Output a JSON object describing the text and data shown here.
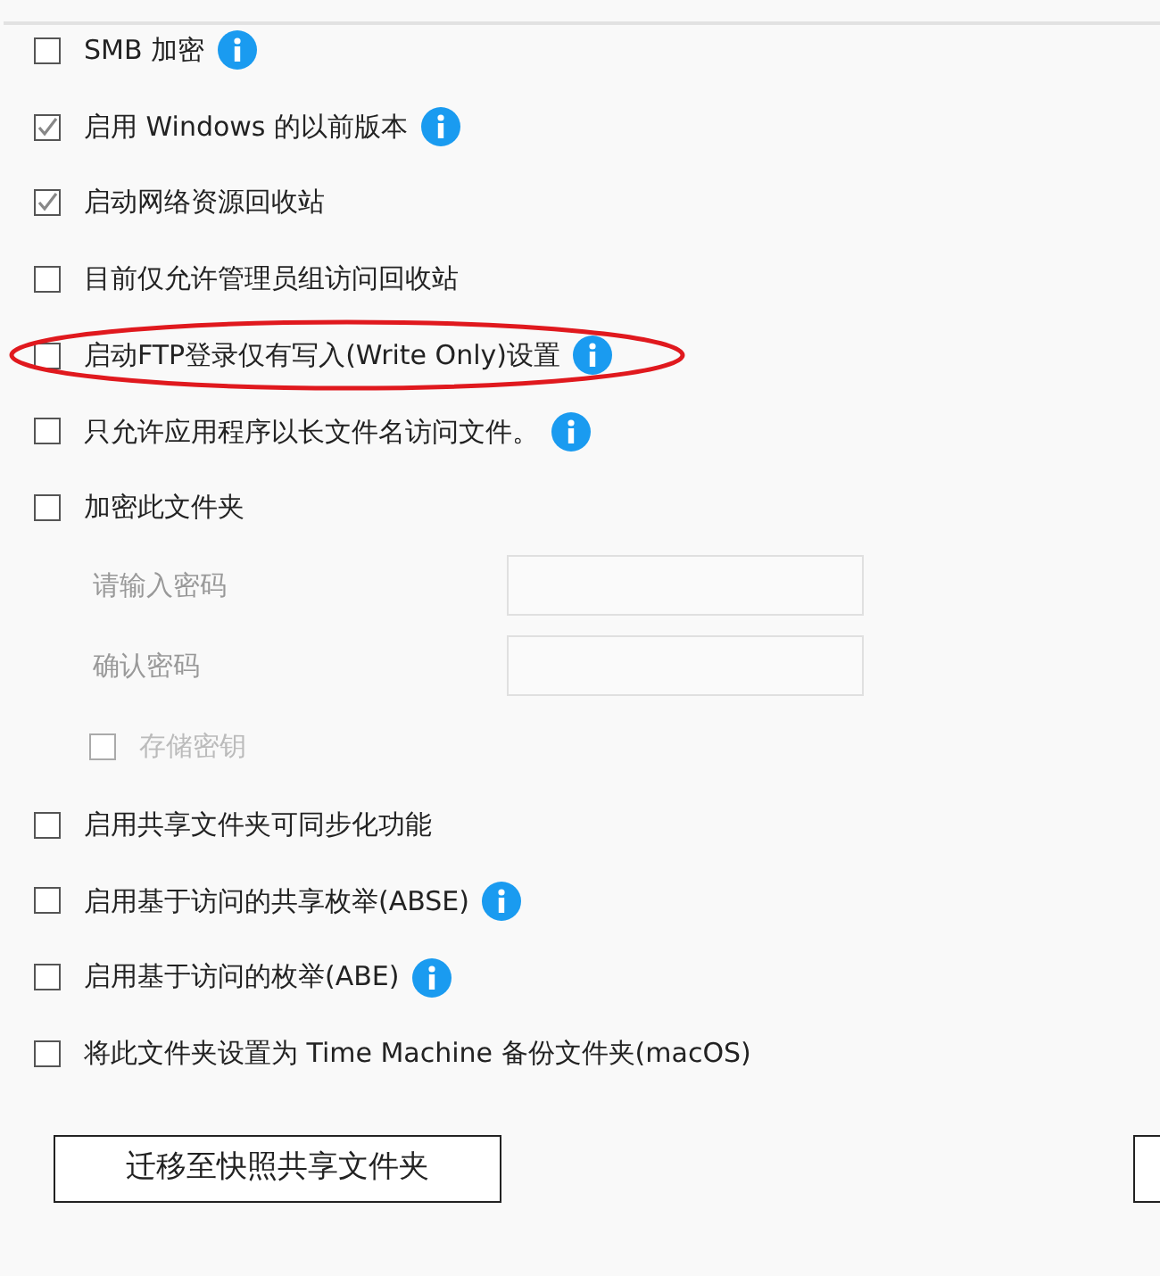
{
  "options": [
    {
      "kind": "checkbox",
      "label": "SMB 加密",
      "checked": false,
      "info": true
    },
    {
      "kind": "checkbox",
      "label": "启用 Windows 的以前版本",
      "checked": true,
      "info": true
    },
    {
      "kind": "checkbox",
      "label": "启动网络资源回收站",
      "checked": true,
      "info": false
    },
    {
      "kind": "checkbox",
      "label": "目前仅允许管理员组访问回收站",
      "checked": false,
      "info": false
    },
    {
      "kind": "checkbox",
      "label": "启动FTP登录仅有写入(Write Only)设置",
      "checked": false,
      "info": true,
      "highlighted": true
    },
    {
      "kind": "checkbox",
      "label": "只允许应用程序以长文件名访问文件。",
      "checked": false,
      "info": true
    },
    {
      "kind": "checkbox",
      "label": "加密此文件夹",
      "checked": false,
      "info": false
    },
    {
      "kind": "field",
      "label": "请输入密码"
    },
    {
      "kind": "field",
      "label": "确认密码"
    },
    {
      "kind": "subcheckbox",
      "label": "存储密钥",
      "checked": false,
      "disabled": true
    },
    {
      "kind": "checkbox",
      "label": "启用共享文件夹可同步化功能",
      "checked": false,
      "info": false
    },
    {
      "kind": "checkbox",
      "label": "启用基于访问的共享枚举(ABSE)",
      "checked": false,
      "info": true
    },
    {
      "kind": "checkbox",
      "label": "启用基于访问的枚举(ABE)",
      "checked": false,
      "info": true
    },
    {
      "kind": "checkbox",
      "label": "将此文件夹设置为 Time Machine 备份文件夹(macOS)",
      "checked": false,
      "info": false
    }
  ],
  "buttons": [
    {
      "label": "迁移至快照共享文件夹"
    }
  ]
}
